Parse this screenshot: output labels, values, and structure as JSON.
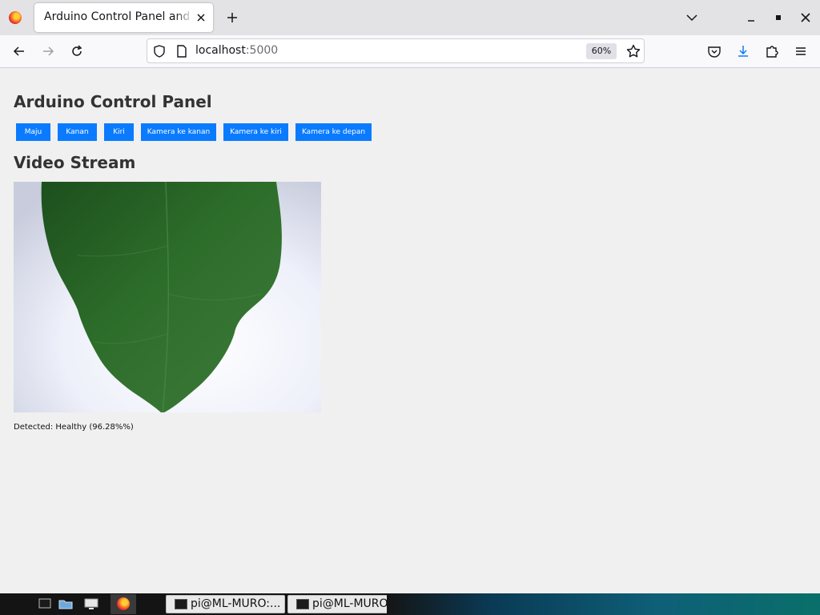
{
  "browser": {
    "tab_title": "Arduino Control Panel and Video Stream",
    "url_host": "localhost",
    "url_port": ":5000",
    "zoom": "60%"
  },
  "page": {
    "heading": "Arduino Control Panel",
    "buttons": [
      "Maju",
      "Kanan",
      "Kiri",
      "Kamera ke kanan",
      "Kamera ke kiri",
      "Kamera ke depan"
    ],
    "video_heading": "Video Stream",
    "status_text": "Detected: Healthy (96.28%%)",
    "accent_color": "#0a7bff"
  },
  "taskbar": {
    "tasks": [
      "pi@ML-MURO:...",
      "pi@ML-MURO:"
    ]
  },
  "icons": [
    "firefox-icon",
    "close-tab-icon",
    "new-tab-icon",
    "tab-list-icon",
    "minimize-icon",
    "maximize-icon",
    "close-window-icon",
    "back-icon",
    "forward-icon",
    "reload-icon",
    "shield-icon",
    "page-icon",
    "bookmark-star-icon",
    "pocket-icon",
    "downloads-icon",
    "extensions-icon",
    "menu-icon",
    "terminal-icon",
    "file-manager-icon",
    "desktop-icon"
  ]
}
